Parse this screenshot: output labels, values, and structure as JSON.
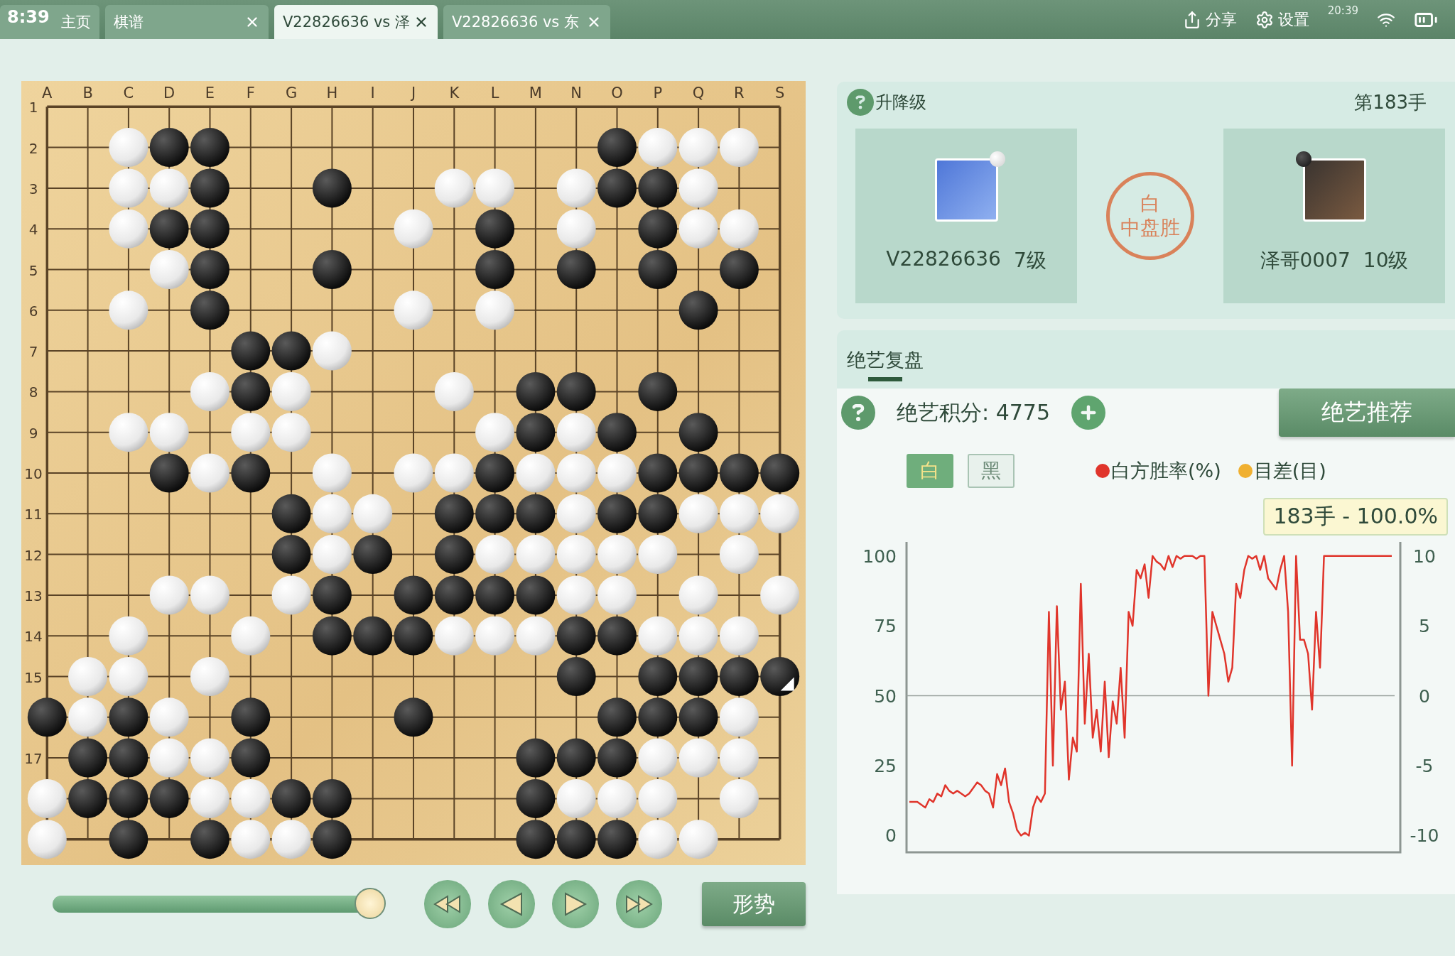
{
  "status_bar": {
    "time": "8:39",
    "clock": "20:39"
  },
  "tabs": [
    {
      "label": "主页",
      "closable": false,
      "selected": false
    },
    {
      "label": "棋谱",
      "closable": true,
      "selected": false
    },
    {
      "label": "V22826636 vs 泽",
      "closable": true,
      "selected": true
    },
    {
      "label": "V22826636 vs 东",
      "closable": true,
      "selected": false
    }
  ],
  "toolbar": [
    {
      "kind": "share",
      "label": "分享"
    },
    {
      "kind": "settings",
      "label": "设置"
    }
  ],
  "board": {
    "columns": [
      "A",
      "B",
      "C",
      "D",
      "E",
      "F",
      "G",
      "H",
      "I",
      "J",
      "K",
      "L",
      "M",
      "N",
      "O",
      "P",
      "Q",
      "R",
      "S"
    ],
    "rows": [
      {
        "label": "1",
        "points": [
          {
            "kind": "empty"
          },
          {
            "kind": "empty"
          },
          {
            "kind": "empty"
          },
          {
            "kind": "empty"
          },
          {
            "kind": "empty"
          },
          {
            "kind": "empty"
          },
          {
            "kind": "empty"
          },
          {
            "kind": "empty"
          },
          {
            "kind": "empty"
          },
          {
            "kind": "empty"
          },
          {
            "kind": "empty"
          },
          {
            "kind": "empty"
          },
          {
            "kind": "empty"
          },
          {
            "kind": "empty"
          },
          {
            "kind": "empty"
          },
          {
            "kind": "empty"
          },
          {
            "kind": "empty"
          },
          {
            "kind": "empty"
          },
          {
            "kind": "empty"
          }
        ]
      },
      {
        "label": "2",
        "points": [
          {
            "kind": "empty"
          },
          {
            "kind": "empty"
          },
          {
            "kind": "white"
          },
          {
            "kind": "black"
          },
          {
            "kind": "black"
          },
          {
            "kind": "empty"
          },
          {
            "kind": "empty"
          },
          {
            "kind": "empty"
          },
          {
            "kind": "empty"
          },
          {
            "kind": "empty"
          },
          {
            "kind": "empty"
          },
          {
            "kind": "empty"
          },
          {
            "kind": "empty"
          },
          {
            "kind": "empty"
          },
          {
            "kind": "black"
          },
          {
            "kind": "white"
          },
          {
            "kind": "white"
          },
          {
            "kind": "white"
          },
          {
            "kind": "empty"
          }
        ]
      },
      {
        "label": "3",
        "points": [
          {
            "kind": "empty"
          },
          {
            "kind": "empty"
          },
          {
            "kind": "white"
          },
          {
            "kind": "white"
          },
          {
            "kind": "black"
          },
          {
            "kind": "empty"
          },
          {
            "kind": "empty"
          },
          {
            "kind": "black"
          },
          {
            "kind": "empty"
          },
          {
            "kind": "empty"
          },
          {
            "kind": "white"
          },
          {
            "kind": "white"
          },
          {
            "kind": "empty"
          },
          {
            "kind": "white"
          },
          {
            "kind": "black"
          },
          {
            "kind": "black"
          },
          {
            "kind": "white"
          },
          {
            "kind": "empty"
          },
          {
            "kind": "empty"
          }
        ]
      },
      {
        "label": "4",
        "points": [
          {
            "kind": "empty"
          },
          {
            "kind": "empty"
          },
          {
            "kind": "white"
          },
          {
            "kind": "black"
          },
          {
            "kind": "black"
          },
          {
            "kind": "empty"
          },
          {
            "kind": "empty"
          },
          {
            "kind": "empty"
          },
          {
            "kind": "empty"
          },
          {
            "kind": "white"
          },
          {
            "kind": "empty"
          },
          {
            "kind": "black"
          },
          {
            "kind": "empty"
          },
          {
            "kind": "white"
          },
          {
            "kind": "empty"
          },
          {
            "kind": "black"
          },
          {
            "kind": "white"
          },
          {
            "kind": "white"
          },
          {
            "kind": "empty"
          }
        ]
      },
      {
        "label": "5",
        "points": [
          {
            "kind": "empty"
          },
          {
            "kind": "empty"
          },
          {
            "kind": "empty"
          },
          {
            "kind": "white"
          },
          {
            "kind": "black"
          },
          {
            "kind": "empty"
          },
          {
            "kind": "empty"
          },
          {
            "kind": "black"
          },
          {
            "kind": "empty"
          },
          {
            "kind": "empty"
          },
          {
            "kind": "empty"
          },
          {
            "kind": "black"
          },
          {
            "kind": "empty"
          },
          {
            "kind": "black"
          },
          {
            "kind": "empty"
          },
          {
            "kind": "black"
          },
          {
            "kind": "empty"
          },
          {
            "kind": "black"
          },
          {
            "kind": "empty"
          }
        ]
      },
      {
        "label": "6",
        "points": [
          {
            "kind": "empty"
          },
          {
            "kind": "empty"
          },
          {
            "kind": "white"
          },
          {
            "kind": "empty"
          },
          {
            "kind": "black"
          },
          {
            "kind": "empty"
          },
          {
            "kind": "empty"
          },
          {
            "kind": "empty"
          },
          {
            "kind": "empty"
          },
          {
            "kind": "white"
          },
          {
            "kind": "empty"
          },
          {
            "kind": "white"
          },
          {
            "kind": "empty"
          },
          {
            "kind": "empty"
          },
          {
            "kind": "empty"
          },
          {
            "kind": "empty"
          },
          {
            "kind": "black"
          },
          {
            "kind": "empty"
          },
          {
            "kind": "empty"
          }
        ]
      },
      {
        "label": "7",
        "points": [
          {
            "kind": "empty"
          },
          {
            "kind": "empty"
          },
          {
            "kind": "empty"
          },
          {
            "kind": "empty"
          },
          {
            "kind": "empty"
          },
          {
            "kind": "black"
          },
          {
            "kind": "black"
          },
          {
            "kind": "white"
          },
          {
            "kind": "empty"
          },
          {
            "kind": "empty"
          },
          {
            "kind": "empty"
          },
          {
            "kind": "empty"
          },
          {
            "kind": "empty"
          },
          {
            "kind": "empty"
          },
          {
            "kind": "empty"
          },
          {
            "kind": "empty"
          },
          {
            "kind": "empty"
          },
          {
            "kind": "empty"
          },
          {
            "kind": "empty"
          }
        ]
      },
      {
        "label": "8",
        "points": [
          {
            "kind": "empty"
          },
          {
            "kind": "empty"
          },
          {
            "kind": "empty"
          },
          {
            "kind": "empty"
          },
          {
            "kind": "white"
          },
          {
            "kind": "black"
          },
          {
            "kind": "white"
          },
          {
            "kind": "empty"
          },
          {
            "kind": "empty"
          },
          {
            "kind": "empty"
          },
          {
            "kind": "white"
          },
          {
            "kind": "empty"
          },
          {
            "kind": "black"
          },
          {
            "kind": "black"
          },
          {
            "kind": "empty"
          },
          {
            "kind": "black"
          },
          {
            "kind": "empty"
          },
          {
            "kind": "empty"
          },
          {
            "kind": "empty"
          }
        ]
      },
      {
        "label": "9",
        "points": [
          {
            "kind": "empty"
          },
          {
            "kind": "empty"
          },
          {
            "kind": "white"
          },
          {
            "kind": "white"
          },
          {
            "kind": "empty"
          },
          {
            "kind": "white"
          },
          {
            "kind": "white"
          },
          {
            "kind": "empty"
          },
          {
            "kind": "empty"
          },
          {
            "kind": "empty"
          },
          {
            "kind": "empty"
          },
          {
            "kind": "white"
          },
          {
            "kind": "black"
          },
          {
            "kind": "white"
          },
          {
            "kind": "black"
          },
          {
            "kind": "empty"
          },
          {
            "kind": "black"
          },
          {
            "kind": "empty"
          },
          {
            "kind": "empty"
          }
        ]
      },
      {
        "label": "10",
        "points": [
          {
            "kind": "empty"
          },
          {
            "kind": "empty"
          },
          {
            "kind": "empty"
          },
          {
            "kind": "black"
          },
          {
            "kind": "white"
          },
          {
            "kind": "black"
          },
          {
            "kind": "empty"
          },
          {
            "kind": "white"
          },
          {
            "kind": "empty"
          },
          {
            "kind": "white"
          },
          {
            "kind": "white"
          },
          {
            "kind": "black"
          },
          {
            "kind": "white"
          },
          {
            "kind": "white"
          },
          {
            "kind": "white"
          },
          {
            "kind": "black"
          },
          {
            "kind": "black"
          },
          {
            "kind": "black"
          },
          {
            "kind": "black"
          }
        ]
      },
      {
        "label": "11",
        "points": [
          {
            "kind": "empty"
          },
          {
            "kind": "empty"
          },
          {
            "kind": "empty"
          },
          {
            "kind": "empty"
          },
          {
            "kind": "empty"
          },
          {
            "kind": "empty"
          },
          {
            "kind": "black"
          },
          {
            "kind": "white"
          },
          {
            "kind": "white"
          },
          {
            "kind": "empty"
          },
          {
            "kind": "black"
          },
          {
            "kind": "black"
          },
          {
            "kind": "black"
          },
          {
            "kind": "white"
          },
          {
            "kind": "black"
          },
          {
            "kind": "black"
          },
          {
            "kind": "white"
          },
          {
            "kind": "white"
          },
          {
            "kind": "white"
          }
        ]
      },
      {
        "label": "12",
        "points": [
          {
            "kind": "empty"
          },
          {
            "kind": "empty"
          },
          {
            "kind": "empty"
          },
          {
            "kind": "empty"
          },
          {
            "kind": "empty"
          },
          {
            "kind": "empty"
          },
          {
            "kind": "black"
          },
          {
            "kind": "white"
          },
          {
            "kind": "black"
          },
          {
            "kind": "empty"
          },
          {
            "kind": "black"
          },
          {
            "kind": "white"
          },
          {
            "kind": "white"
          },
          {
            "kind": "white"
          },
          {
            "kind": "white"
          },
          {
            "kind": "white"
          },
          {
            "kind": "empty"
          },
          {
            "kind": "white"
          },
          {
            "kind": "empty"
          }
        ]
      },
      {
        "label": "13",
        "points": [
          {
            "kind": "empty"
          },
          {
            "kind": "empty"
          },
          {
            "kind": "empty"
          },
          {
            "kind": "white"
          },
          {
            "kind": "white"
          },
          {
            "kind": "empty"
          },
          {
            "kind": "white"
          },
          {
            "kind": "black"
          },
          {
            "kind": "empty"
          },
          {
            "kind": "black"
          },
          {
            "kind": "black"
          },
          {
            "kind": "black"
          },
          {
            "kind": "black"
          },
          {
            "kind": "white"
          },
          {
            "kind": "white"
          },
          {
            "kind": "empty"
          },
          {
            "kind": "white"
          },
          {
            "kind": "empty"
          },
          {
            "kind": "white"
          }
        ]
      },
      {
        "label": "14",
        "points": [
          {
            "kind": "empty"
          },
          {
            "kind": "empty"
          },
          {
            "kind": "white"
          },
          {
            "kind": "empty"
          },
          {
            "kind": "empty"
          },
          {
            "kind": "white"
          },
          {
            "kind": "empty"
          },
          {
            "kind": "black"
          },
          {
            "kind": "black"
          },
          {
            "kind": "black"
          },
          {
            "kind": "white"
          },
          {
            "kind": "white"
          },
          {
            "kind": "white"
          },
          {
            "kind": "black"
          },
          {
            "kind": "black"
          },
          {
            "kind": "white"
          },
          {
            "kind": "white"
          },
          {
            "kind": "white"
          },
          {
            "kind": "empty"
          }
        ]
      },
      {
        "label": "15",
        "points": [
          {
            "kind": "empty"
          },
          {
            "kind": "white"
          },
          {
            "kind": "white"
          },
          {
            "kind": "empty"
          },
          {
            "kind": "white"
          },
          {
            "kind": "empty"
          },
          {
            "kind": "empty"
          },
          {
            "kind": "empty"
          },
          {
            "kind": "empty"
          },
          {
            "kind": "empty"
          },
          {
            "kind": "empty"
          },
          {
            "kind": "empty"
          },
          {
            "kind": "empty"
          },
          {
            "kind": "black"
          },
          {
            "kind": "empty"
          },
          {
            "kind": "black"
          },
          {
            "kind": "black"
          },
          {
            "kind": "black"
          },
          {
            "kind": "black",
            "last_move": true
          }
        ]
      },
      {
        "points": [
          {
            "kind": "black"
          },
          {
            "kind": "white"
          },
          {
            "kind": "black"
          },
          {
            "kind": "white"
          },
          {
            "kind": "empty"
          },
          {
            "kind": "black"
          },
          {
            "kind": "empty"
          },
          {
            "kind": "empty"
          },
          {
            "kind": "empty"
          },
          {
            "kind": "black"
          },
          {
            "kind": "empty"
          },
          {
            "kind": "empty"
          },
          {
            "kind": "empty"
          },
          {
            "kind": "empty"
          },
          {
            "kind": "black"
          },
          {
            "kind": "black"
          },
          {
            "kind": "black"
          },
          {
            "kind": "white"
          },
          {
            "kind": "empty"
          }
        ]
      },
      {
        "label": "17",
        "points": [
          {
            "kind": "empty"
          },
          {
            "kind": "black"
          },
          {
            "kind": "black"
          },
          {
            "kind": "white"
          },
          {
            "kind": "white"
          },
          {
            "kind": "black"
          },
          {
            "kind": "empty"
          },
          {
            "kind": "empty"
          },
          {
            "kind": "empty"
          },
          {
            "kind": "empty"
          },
          {
            "kind": "empty"
          },
          {
            "kind": "empty"
          },
          {
            "kind": "black"
          },
          {
            "kind": "black"
          },
          {
            "kind": "black"
          },
          {
            "kind": "white"
          },
          {
            "kind": "white"
          },
          {
            "kind": "white"
          },
          {
            "kind": "empty"
          }
        ]
      },
      {
        "points": [
          {
            "kind": "white"
          },
          {
            "kind": "black"
          },
          {
            "kind": "black"
          },
          {
            "kind": "black"
          },
          {
            "kind": "white"
          },
          {
            "kind": "white"
          },
          {
            "kind": "black"
          },
          {
            "kind": "black"
          },
          {
            "kind": "empty"
          },
          {
            "kind": "empty"
          },
          {
            "kind": "empty"
          },
          {
            "kind": "empty"
          },
          {
            "kind": "black"
          },
          {
            "kind": "white"
          },
          {
            "kind": "white"
          },
          {
            "kind": "white"
          },
          {
            "kind": "empty"
          },
          {
            "kind": "white"
          },
          {
            "kind": "empty"
          }
        ]
      },
      {
        "points": [
          {
            "kind": "white"
          },
          {
            "kind": "empty"
          },
          {
            "kind": "black"
          },
          {
            "kind": "empty"
          },
          {
            "kind": "black"
          },
          {
            "kind": "white"
          },
          {
            "kind": "white"
          },
          {
            "kind": "black"
          },
          {
            "kind": "empty"
          },
          {
            "kind": "empty"
          },
          {
            "kind": "empty"
          },
          {
            "kind": "empty"
          },
          {
            "kind": "black"
          },
          {
            "kind": "black"
          },
          {
            "kind": "black"
          },
          {
            "kind": "white"
          },
          {
            "kind": "white"
          },
          {
            "kind": "empty"
          },
          {
            "kind": "empty"
          }
        ]
      }
    ]
  },
  "playback": {
    "level": 1,
    "buttons": [
      {
        "kind": "first"
      },
      {
        "kind": "prev"
      },
      {
        "kind": "next"
      },
      {
        "kind": "last"
      }
    ],
    "judge_button": "形势"
  },
  "game_info": {
    "help_label": "升降级",
    "move_label": "第183手",
    "players": [
      {
        "name": "V22826636",
        "rank": "7级",
        "kind": "white"
      },
      {
        "name": "泽哥0007",
        "rank": "10级",
        "kind": "black"
      }
    ],
    "result": {
      "winner": "白",
      "method": "中盘胜"
    }
  },
  "analysis": {
    "tabs": [
      {
        "label": "绝艺复盘",
        "selected": true
      }
    ],
    "score_label": "绝艺积分: 4775",
    "recommend_button": "绝艺推荐",
    "side_toggle": [
      {
        "label": "白",
        "selected": true
      },
      {
        "label": "黑",
        "selected": false
      }
    ],
    "legend": [
      {
        "label": "白方胜率(%)",
        "color": "#e0352b"
      },
      {
        "label": "目差(目)",
        "color": "#f0b030"
      }
    ],
    "tooltip": "183手 - 100.0%",
    "chart_data": {
      "type": "line",
      "ylim": [
        -6,
        105
      ],
      "yticks": [
        0,
        25,
        50,
        75,
        100
      ],
      "y2lim": [
        -11.2,
        11
      ],
      "y2ticks": [
        10,
        5,
        0,
        -5,
        -10
      ],
      "series": [
        {
          "color": "#e0352b",
          "values": [
            12,
            12,
            12,
            11,
            10,
            13,
            12,
            15,
            14,
            18,
            16,
            15,
            16,
            15,
            14,
            15,
            17,
            19,
            18,
            16,
            15,
            10,
            22,
            18,
            24,
            12,
            8,
            2,
            0,
            1,
            0,
            10,
            14,
            12,
            15,
            80,
            25,
            82,
            45,
            55,
            20,
            35,
            30,
            90,
            40,
            65,
            35,
            45,
            30,
            55,
            28,
            48,
            40,
            60,
            35,
            80,
            75,
            95,
            92,
            97,
            85,
            100,
            98,
            97,
            95,
            100,
            96,
            100,
            99,
            100,
            100,
            100,
            99,
            100,
            100,
            50,
            80,
            75,
            70,
            65,
            55,
            60,
            90,
            85,
            95,
            100,
            99,
            100,
            95,
            100,
            92,
            90,
            88,
            95,
            100,
            80,
            25,
            100,
            70,
            70,
            65,
            45,
            80,
            60,
            100,
            100,
            100,
            100,
            100,
            100,
            100,
            100,
            100,
            100,
            100,
            100,
            100,
            100,
            100,
            100,
            100,
            100
          ]
        }
      ]
    }
  }
}
